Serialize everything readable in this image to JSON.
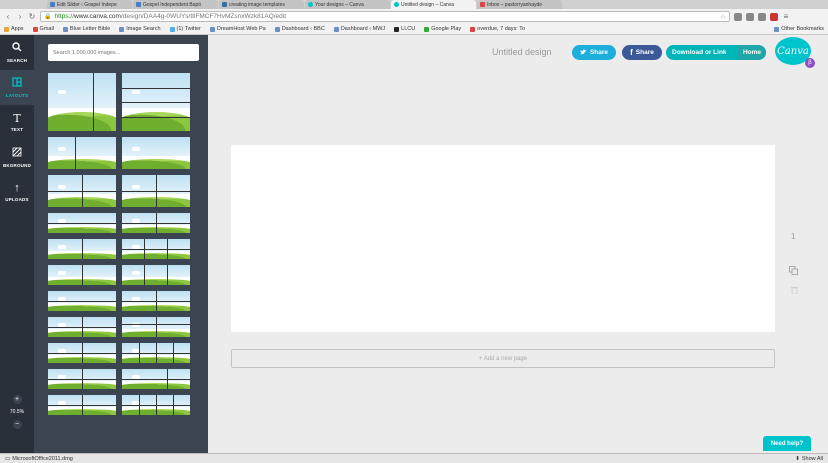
{
  "browser": {
    "tabs": [
      {
        "label": "Edit Slider ‹ Gospel Indepe",
        "icon": "page-icon",
        "active": false
      },
      {
        "label": "Gospel Independent Bapti",
        "icon": "page-icon",
        "active": false
      },
      {
        "label": "creating image templates",
        "icon": "google-icon",
        "active": false
      },
      {
        "label": "Your designs – Canva",
        "icon": "canva-icon",
        "active": false
      },
      {
        "label": "Untitled design – Canva",
        "icon": "canva-icon",
        "active": true
      },
      {
        "label": "Inbox – pastorryanhayde",
        "icon": "gmail-icon",
        "active": false
      }
    ],
    "url_prefix": "https://",
    "url_domain": "www.canva.com",
    "url_path": "/design/DAA4g-0WUYs/ttlFMCF7HvMZsnxWzk81AQ/edit",
    "bookmarks": [
      "Apps",
      "Gmail",
      "Blue Letter Bible",
      "Image Search",
      "(1) Twitter",
      "DreamHost Web Pa",
      "Dashboard ‹ BBC",
      "Dashboard ‹ MWJ",
      "LLCU",
      "Google Play",
      "overdue, 7 days: To"
    ],
    "other_bookmarks": "Other Bookmarks"
  },
  "sidebar": {
    "items": [
      {
        "label": "SEARCH",
        "icon": "search-icon"
      },
      {
        "label": "LAYOUTS",
        "icon": "layouts-icon"
      },
      {
        "label": "TEXT",
        "icon": "text-icon"
      },
      {
        "label": "BKGROUND",
        "icon": "background-icon"
      },
      {
        "label": "UPLOADS",
        "icon": "upload-icon"
      }
    ],
    "zoom_level": "70.5%"
  },
  "panel": {
    "search_placeholder": "Search 1,000,000 images..."
  },
  "header": {
    "doc_title": "Untitled design",
    "share_label": "Share",
    "fb_share_label": "Share",
    "download_label": "Download or Link",
    "home_label": "Home",
    "logo_text": "Canva",
    "beta_badge": "β"
  },
  "editor": {
    "add_page_label": "+ Add a new page",
    "page_number": "1",
    "help_label": "Need help?"
  },
  "downloads": {
    "file_name": "MicrosoftOffice2011.dmg",
    "show_all": "Show All"
  },
  "colors": {
    "accent": "#00c4cc",
    "share_blue": "#1eaedc",
    "facebook_blue": "#3b5998",
    "sidebar_dark": "#293039",
    "panel_dark": "#3a4551"
  }
}
